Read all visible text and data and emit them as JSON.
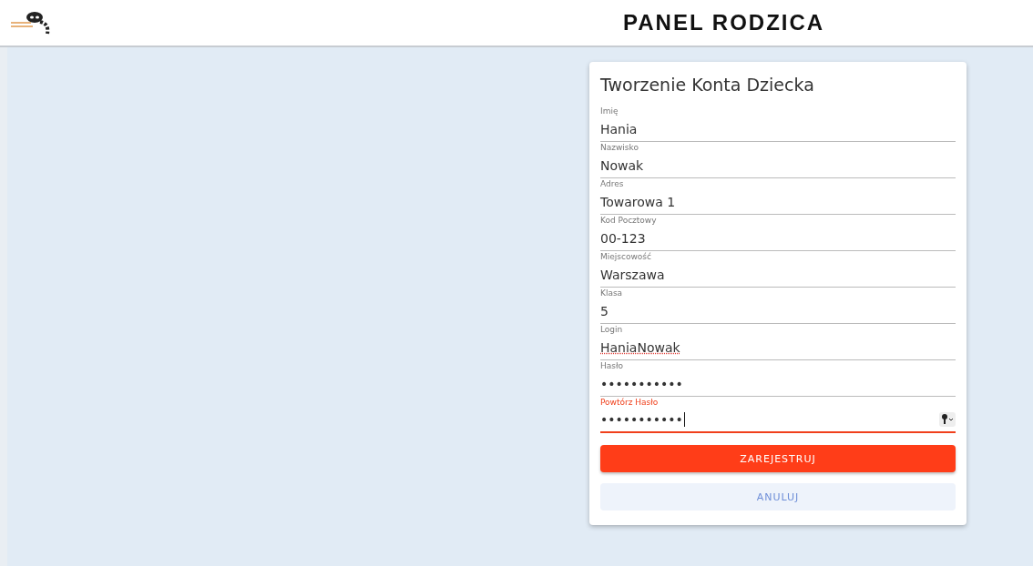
{
  "header": {
    "title": "PANEL RODZICA"
  },
  "form": {
    "title": "Tworzenie Konta Dziecka",
    "fields": [
      {
        "label": "Imię",
        "value": "Hania",
        "focused": false,
        "misspelled": false
      },
      {
        "label": "Nazwisko",
        "value": "Nowak",
        "focused": false,
        "misspelled": false
      },
      {
        "label": "Adres",
        "value": "Towarowa 1",
        "focused": false,
        "misspelled": false
      },
      {
        "label": "Kod Pocztowy",
        "value": "00-123",
        "focused": false,
        "misspelled": false
      },
      {
        "label": "Miejscowość",
        "value": "Warszawa",
        "focused": false,
        "misspelled": false
      },
      {
        "label": "Klasa",
        "value": "5",
        "focused": false,
        "misspelled": false
      },
      {
        "label": "Login",
        "value": "HaniaNowak",
        "focused": false,
        "misspelled": true
      },
      {
        "label": "Hasło",
        "value": "•••••••••••",
        "focused": false,
        "misspelled": false
      },
      {
        "label": "Powtórz Hasło",
        "value": "•••••••••••",
        "focused": true,
        "misspelled": false
      }
    ],
    "buttons": [
      {
        "label": "ZAREJESTRUJ",
        "kind": "primary"
      },
      {
        "label": "ANULUJ",
        "kind": "secondary"
      }
    ]
  }
}
